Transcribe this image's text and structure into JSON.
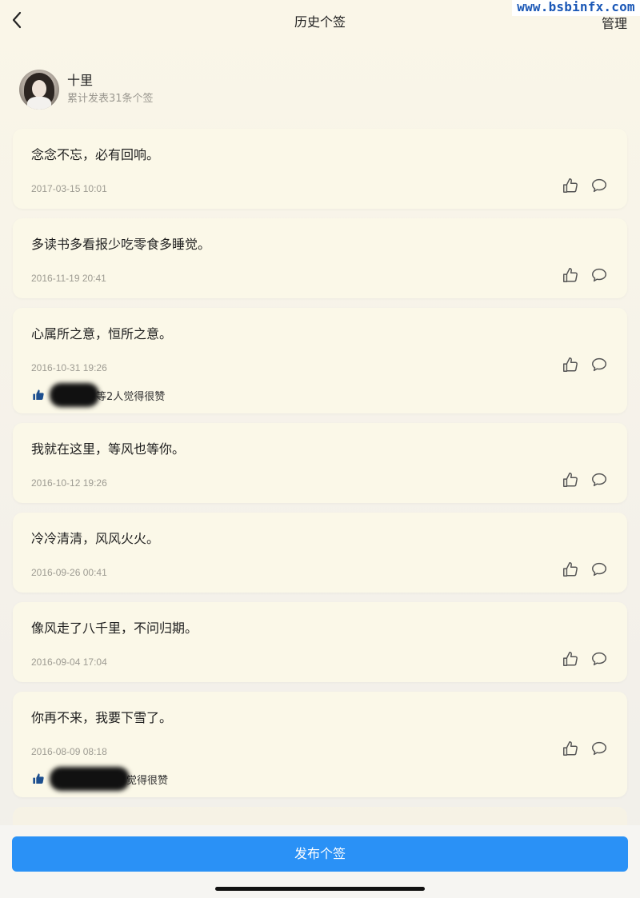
{
  "watermark": "www.bsbinfx.com",
  "nav": {
    "title": "历史个签",
    "manage_label": "管理"
  },
  "icons": {
    "back": "chevron-left-icon",
    "like": "thumbs-up-outline-icon",
    "comment": "speech-bubble-icon",
    "liked": "thumbs-up-filled-icon"
  },
  "profile": {
    "name": "十里",
    "stats": "累计发表31条个签"
  },
  "posts": [
    {
      "text": "念念不忘，必有回响。",
      "date": "2017-03-15 10:01"
    },
    {
      "text": "多读书多看报少吃零食多睡觉。",
      "date": "2016-11-19 20:41"
    },
    {
      "text": "心属所之意，恒所之意。",
      "date": "2016-10-31 19:26",
      "likes_text": "等2人觉得很赞"
    },
    {
      "text": "我就在这里，等风也等你。",
      "date": "2016-10-12 19:26"
    },
    {
      "text": "冷冷清清，风风火火。",
      "date": "2016-09-26 00:41"
    },
    {
      "text": "像风走了八千里，不问归期。",
      "date": "2016-09-04 17:04"
    },
    {
      "text": "你再不来，我要下雪了。",
      "date": "2016-08-09 08:18",
      "likes_text": "觉得很赞"
    }
  ],
  "publish_label": "发布个签",
  "colors": {
    "accent": "#2a91f6",
    "card": "#fbf8e8",
    "liked_icon": "#1d4f8f"
  }
}
